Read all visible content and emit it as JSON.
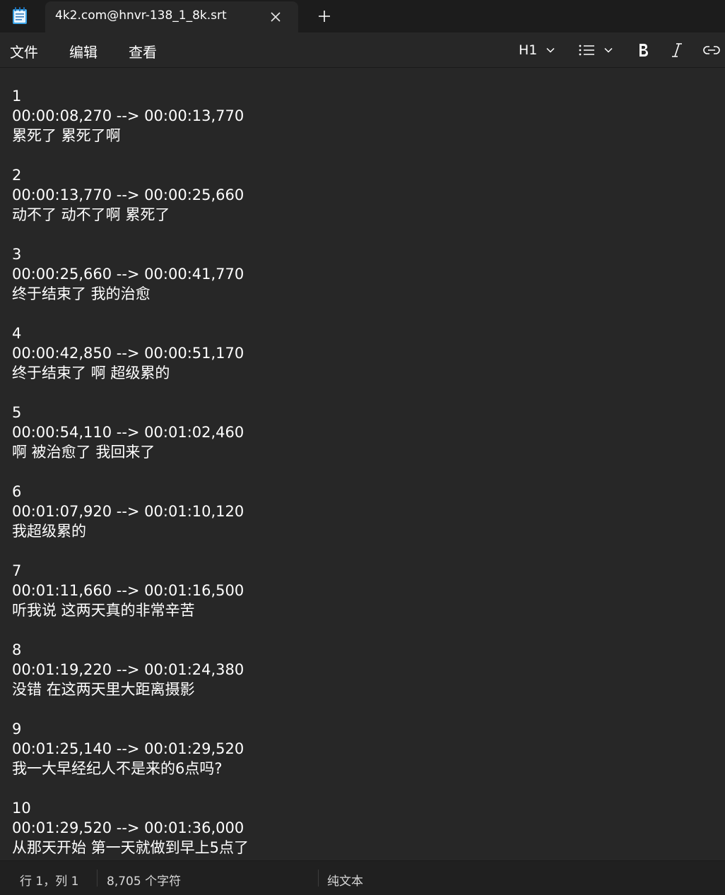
{
  "tab": {
    "title": "4k2.com@hnvr-138_1_8k.srt"
  },
  "menu": {
    "file": "文件",
    "edit": "编辑",
    "view": "查看"
  },
  "toolbar": {
    "heading": "H1"
  },
  "content": {
    "lines": [
      "1",
      "00:00:08,270 --> 00:00:13,770",
      "累死了 累死了啊",
      "",
      "2",
      "00:00:13,770 --> 00:00:25,660",
      "动不了 动不了啊 累死了",
      "",
      "3",
      "00:00:25,660 --> 00:00:41,770",
      "终于结束了 我的治愈",
      "",
      "4",
      "00:00:42,850 --> 00:00:51,170",
      "终于结束了 啊 超级累的",
      "",
      "5",
      "00:00:54,110 --> 00:01:02,460",
      "啊 被治愈了 我回来了",
      "",
      "6",
      "00:01:07,920 --> 00:01:10,120",
      "我超级累的",
      "",
      "7",
      "00:01:11,660 --> 00:01:16,500",
      "听我说 这两天真的非常辛苦",
      "",
      "8",
      "00:01:19,220 --> 00:01:24,380",
      "没错 在这两天里大距离摄影",
      "",
      "9",
      "00:01:25,140 --> 00:01:29,520",
      "我一大早经纪人不是来的6点吗?",
      "",
      "10",
      "00:01:29,520 --> 00:01:36,000",
      "从那天开始 第一天就做到早上5点了"
    ]
  },
  "status": {
    "position": "行 1，列 1",
    "chars": "8,705 个字符",
    "format": "纯文本"
  }
}
